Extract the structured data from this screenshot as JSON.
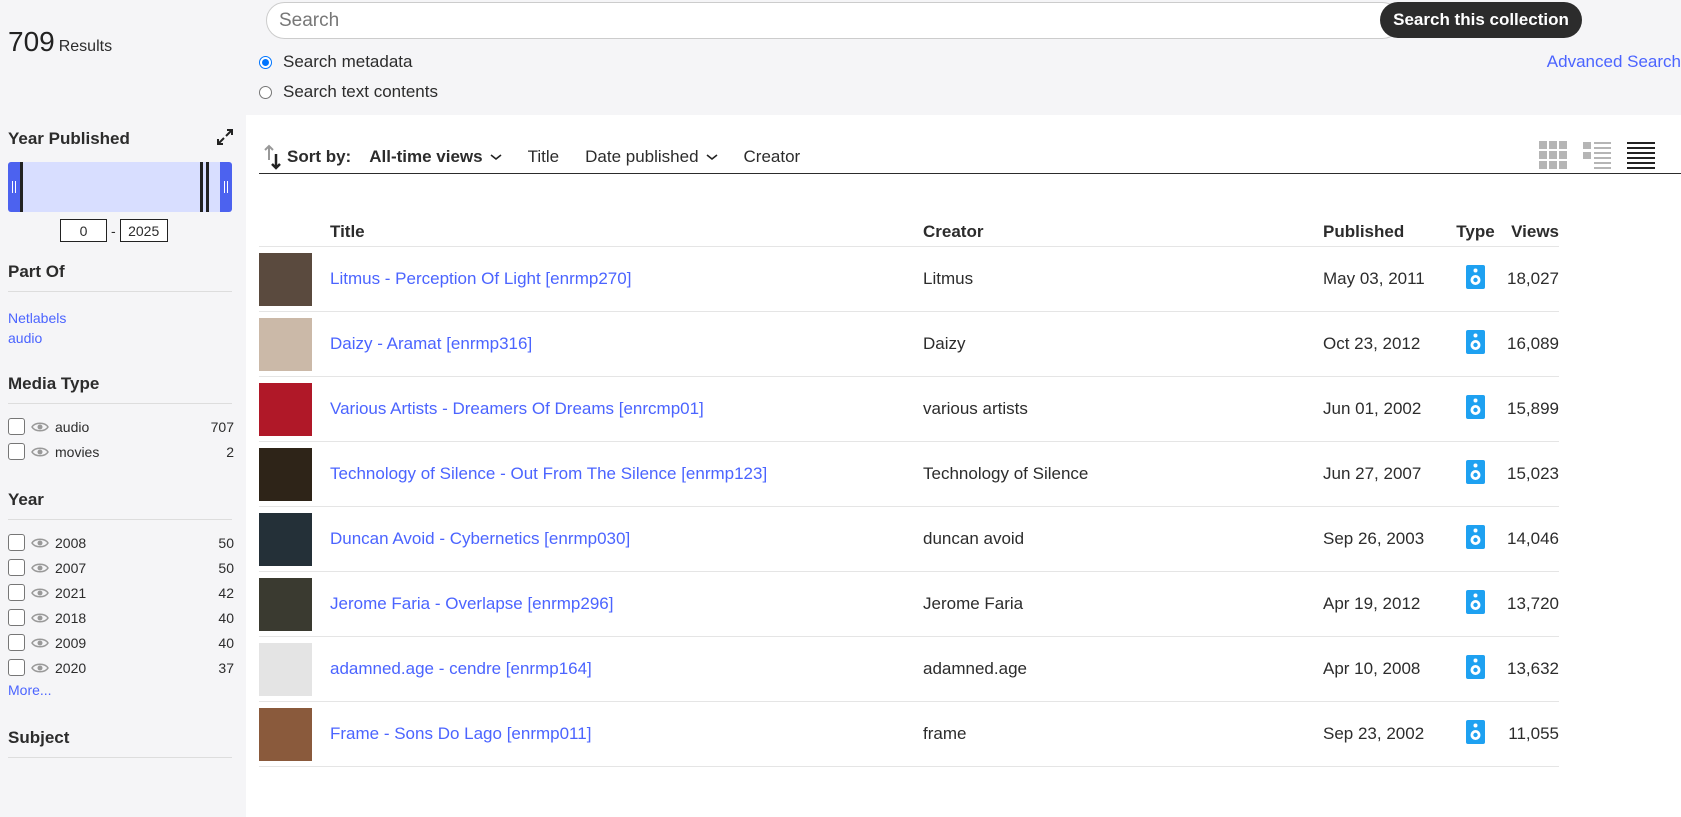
{
  "results": {
    "count": "709",
    "label": "Results"
  },
  "search": {
    "placeholder": "Search",
    "button": "Search this collection",
    "options": [
      "Search metadata",
      "Search text contents"
    ],
    "selected": "Search metadata",
    "advanced": "Advanced Search"
  },
  "year_published": {
    "title": "Year Published",
    "min": "0",
    "max": "2025",
    "dash": "-"
  },
  "part_of": {
    "title": "Part Of",
    "links": [
      "Netlabels",
      "audio"
    ]
  },
  "media_type": {
    "title": "Media Type",
    "items": [
      {
        "label": "audio",
        "count": "707"
      },
      {
        "label": "movies",
        "count": "2"
      }
    ]
  },
  "year": {
    "title": "Year",
    "items": [
      {
        "label": "2008",
        "count": "50"
      },
      {
        "label": "2007",
        "count": "50"
      },
      {
        "label": "2021",
        "count": "42"
      },
      {
        "label": "2018",
        "count": "40"
      },
      {
        "label": "2009",
        "count": "40"
      },
      {
        "label": "2020",
        "count": "37"
      }
    ],
    "more": "More..."
  },
  "subject": {
    "title": "Subject"
  },
  "sort": {
    "label": "Sort by:",
    "options": [
      "All-time views",
      "Title",
      "Date published",
      "Creator"
    ],
    "active": "All-time views"
  },
  "table": {
    "headers": {
      "title": "Title",
      "creator": "Creator",
      "published": "Published",
      "type": "Type",
      "views": "Views"
    },
    "rows": [
      {
        "title": "Litmus - Perception Of Light [enrmp270]",
        "creator": "Litmus",
        "published": "May 03, 2011",
        "views": "18,027",
        "thumb_color": "#5a4a3e"
      },
      {
        "title": "Daizy - Aramat [enrmp316]",
        "creator": "Daizy",
        "published": "Oct 23, 2012",
        "views": "16,089",
        "thumb_color": "#cbb9a8"
      },
      {
        "title": "Various Artists - Dreamers Of Dreams [enrcmp01]",
        "creator": "various artists",
        "published": "Jun 01, 2002",
        "views": "15,899",
        "thumb_color": "#b01828"
      },
      {
        "title": "Technology of Silence - Out From The Silence [enrmp123]",
        "creator": "Technology of Silence",
        "published": "Jun 27, 2007",
        "views": "15,023",
        "thumb_color": "#2e2418"
      },
      {
        "title": "Duncan Avoid - Cybernetics [enrmp030]",
        "creator": "duncan avoid",
        "published": "Sep 26, 2003",
        "views": "14,046",
        "thumb_color": "#243038"
      },
      {
        "title": "Jerome Faria - Overlapse [enrmp296]",
        "creator": "Jerome Faria",
        "published": "Apr 19, 2012",
        "views": "13,720",
        "thumb_color": "#3a3a30"
      },
      {
        "title": "adamned.age - cendre [enrmp164]",
        "creator": "adamned.age",
        "published": "Apr 10, 2008",
        "views": "13,632",
        "thumb_color": "#e4e4e4"
      },
      {
        "title": "Frame - Sons Do Lago [enrmp011]",
        "creator": "frame",
        "published": "Sep 23, 2002",
        "views": "11,055",
        "thumb_color": "#8a5a3c"
      }
    ]
  },
  "colors": {
    "accent": "#4b64ff",
    "slider": "#4c62ef",
    "type_icon": "#1ea1f1"
  }
}
